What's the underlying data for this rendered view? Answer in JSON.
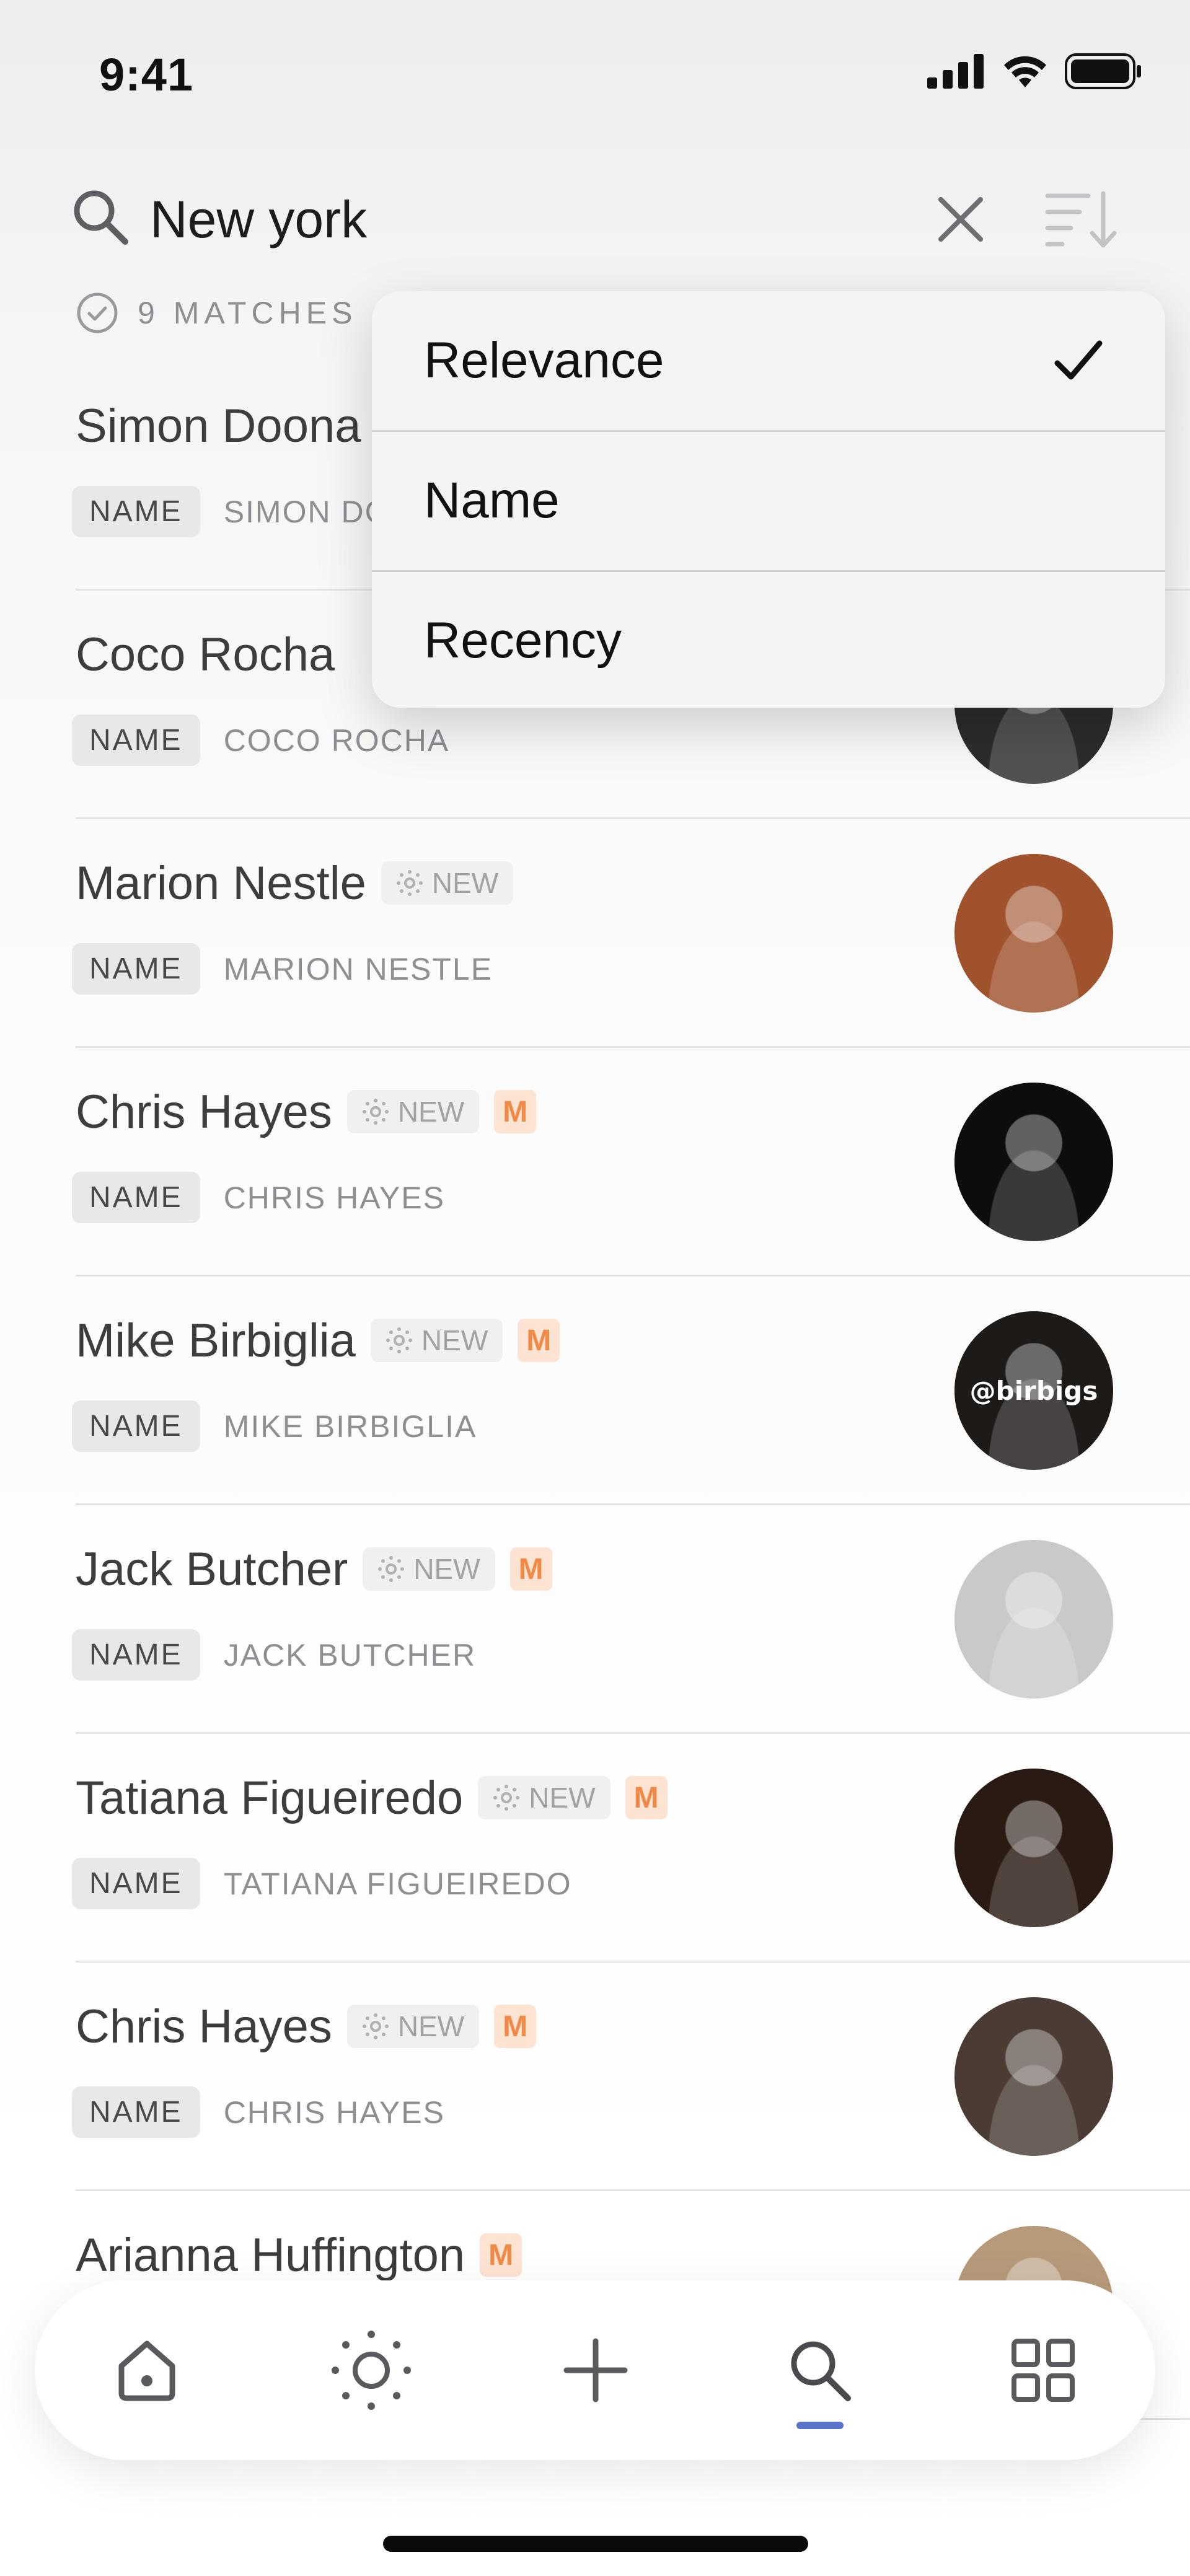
{
  "status_bar": {
    "time": "9:41"
  },
  "search": {
    "query": "New york"
  },
  "results_header": {
    "matches_text": "9 MATCHES"
  },
  "sort_menu": {
    "options": [
      {
        "label": "Relevance",
        "selected": true
      },
      {
        "label": "Name",
        "selected": false
      },
      {
        "label": "Recency",
        "selected": false
      }
    ]
  },
  "results": [
    {
      "name": "Simon Doona",
      "new_label": "",
      "show_m": false,
      "tag": "NAME",
      "sub": "SIMON DC",
      "avatar_color": "#7b7b7b"
    },
    {
      "name": "Coco Rocha",
      "new_label": "",
      "show_m": false,
      "tag": "NAME",
      "sub": "COCO ROCHA",
      "avatar_color": "#2c2c2c"
    },
    {
      "name": "Marion Nestle",
      "new_label": "NEW",
      "show_m": false,
      "tag": "NAME",
      "sub": "MARION NESTLE",
      "avatar_color": "#a0522d"
    },
    {
      "name": "Chris Hayes",
      "new_label": "NEW",
      "show_m": true,
      "m_label": "M",
      "tag": "NAME",
      "sub": "CHRIS HAYES",
      "avatar_color": "#0d0d0d"
    },
    {
      "name": "Mike Birbiglia",
      "new_label": "NEW",
      "show_m": true,
      "m_label": "M",
      "tag": "NAME",
      "sub": "MIKE BIRBIGLIA",
      "avatar_color": "#1e1a18",
      "avatar_text": "@birbigs"
    },
    {
      "name": "Jack Butcher",
      "new_label": "NEW",
      "show_m": true,
      "m_label": "M",
      "tag": "NAME",
      "sub": "JACK BUTCHER",
      "avatar_color": "#c9c9cc"
    },
    {
      "name": "Tatiana Figueiredo",
      "new_label": "NEW",
      "show_m": true,
      "m_label": "M",
      "tag": "NAME",
      "sub": "TATIANA FIGUEIREDO",
      "avatar_color": "#2a1a14"
    },
    {
      "name": "Chris Hayes",
      "new_label": "NEW",
      "show_m": true,
      "m_label": "M",
      "tag": "NAME",
      "sub": "CHRIS HAYES",
      "avatar_color": "#4a3c34"
    },
    {
      "name": "Arianna Huffington",
      "new_label": "",
      "show_m": true,
      "m_label": "M",
      "tag": "",
      "sub": "",
      "avatar_color": "#b79a7a"
    }
  ],
  "tab_bar": {
    "tabs": [
      {
        "icon": "home-icon"
      },
      {
        "icon": "sun-icon"
      },
      {
        "icon": "plus-icon"
      },
      {
        "icon": "search-icon",
        "active": true
      },
      {
        "icon": "grid-icon"
      }
    ],
    "accent": "#5a75c9"
  }
}
